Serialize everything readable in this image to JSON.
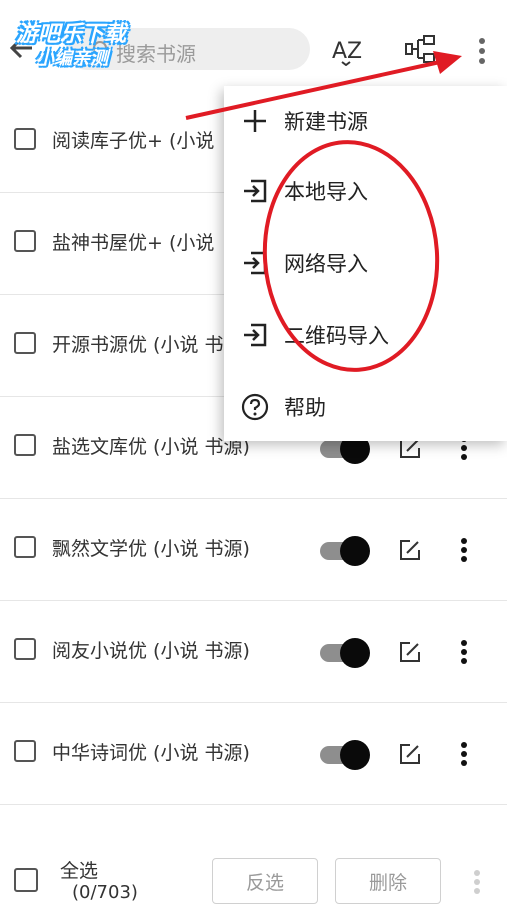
{
  "search": {
    "placeholder": "搜索书源"
  },
  "watermark": {
    "line1": "游吧乐下载",
    "line2": "小编亲测"
  },
  "sources": [
    {
      "label": "阅读库子优+ (小说"
    },
    {
      "label": "盐神书屋优+ (小说"
    },
    {
      "label": "开源书源优 (小说 书"
    },
    {
      "label": "盐选文库优 (小说 书源)",
      "enabled": true
    },
    {
      "label": "飘然文学优 (小说 书源)",
      "enabled": true
    },
    {
      "label": "阅友小说优 (小说 书源)",
      "enabled": true
    },
    {
      "label": "中华诗词优 (小说 书源)",
      "enabled": true
    }
  ],
  "menu": {
    "items": [
      {
        "label": "新建书源",
        "icon": "plus-icon"
      },
      {
        "label": "本地导入",
        "icon": "import-icon"
      },
      {
        "label": "网络导入",
        "icon": "import-icon"
      },
      {
        "label": "二维码导入",
        "icon": "import-icon"
      },
      {
        "label": "帮助",
        "icon": "help-icon"
      }
    ]
  },
  "bottom": {
    "select_all": "全选",
    "count": "(0/703)",
    "invert": "反选",
    "delete": "删除"
  },
  "colors": {
    "annotation": "#e01b24",
    "watermark": "#2aa5ff",
    "toggle_thumb": "#0a0a0a"
  }
}
